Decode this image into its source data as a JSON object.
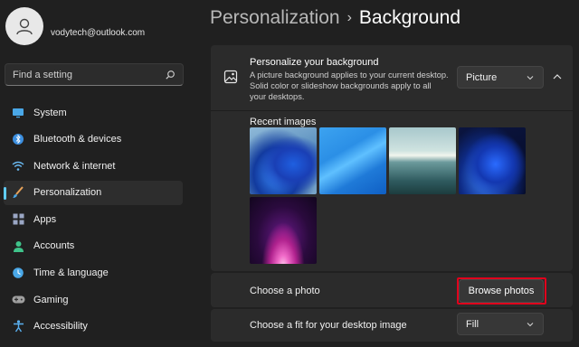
{
  "account": {
    "email": "vodytech@outlook.com"
  },
  "search": {
    "placeholder": "Find a setting"
  },
  "sidebar": {
    "items": [
      {
        "label": "System",
        "icon": "monitor-icon",
        "color": "#4aa8e8"
      },
      {
        "label": "Bluetooth & devices",
        "icon": "bluetooth-icon",
        "color": "#3c8fe0"
      },
      {
        "label": "Network & internet",
        "icon": "wifi-icon",
        "color": "#69b8f0"
      },
      {
        "label": "Personalization",
        "icon": "brush-icon",
        "color": "#e8a35a",
        "active": true
      },
      {
        "label": "Apps",
        "icon": "apps-icon",
        "color": "#9aa6c4"
      },
      {
        "label": "Accounts",
        "icon": "person-icon",
        "color": "#3fc38a"
      },
      {
        "label": "Time & language",
        "icon": "globe-clock-icon",
        "color": "#4aa8e8"
      },
      {
        "label": "Gaming",
        "icon": "gamepad-icon",
        "color": "#a0a0a0"
      },
      {
        "label": "Accessibility",
        "icon": "accessibility-icon",
        "color": "#5ab0f0"
      }
    ]
  },
  "header": {
    "parent": "Personalization",
    "separator": "›",
    "current": "Background"
  },
  "background": {
    "title": "Personalize your background",
    "description": "A picture background applies to your current desktop. Solid color or slideshow backgrounds apply to all your desktops.",
    "type_value": "Picture",
    "recent_label": "Recent images",
    "recent_images": [
      "bloom-light-wallpaper",
      "blue-flow-wallpaper",
      "lake-sunrise-wallpaper",
      "bloom-dark-wallpaper",
      "glow-purple-wallpaper"
    ],
    "choose_photo_label": "Choose a photo",
    "browse_button": "Browse photos",
    "fit_label": "Choose a fit for your desktop image",
    "fit_value": "Fill"
  },
  "colors": {
    "accent": "#60cdff",
    "highlight": "#e0001c",
    "background": "#202020",
    "card": "#2b2b2b"
  }
}
